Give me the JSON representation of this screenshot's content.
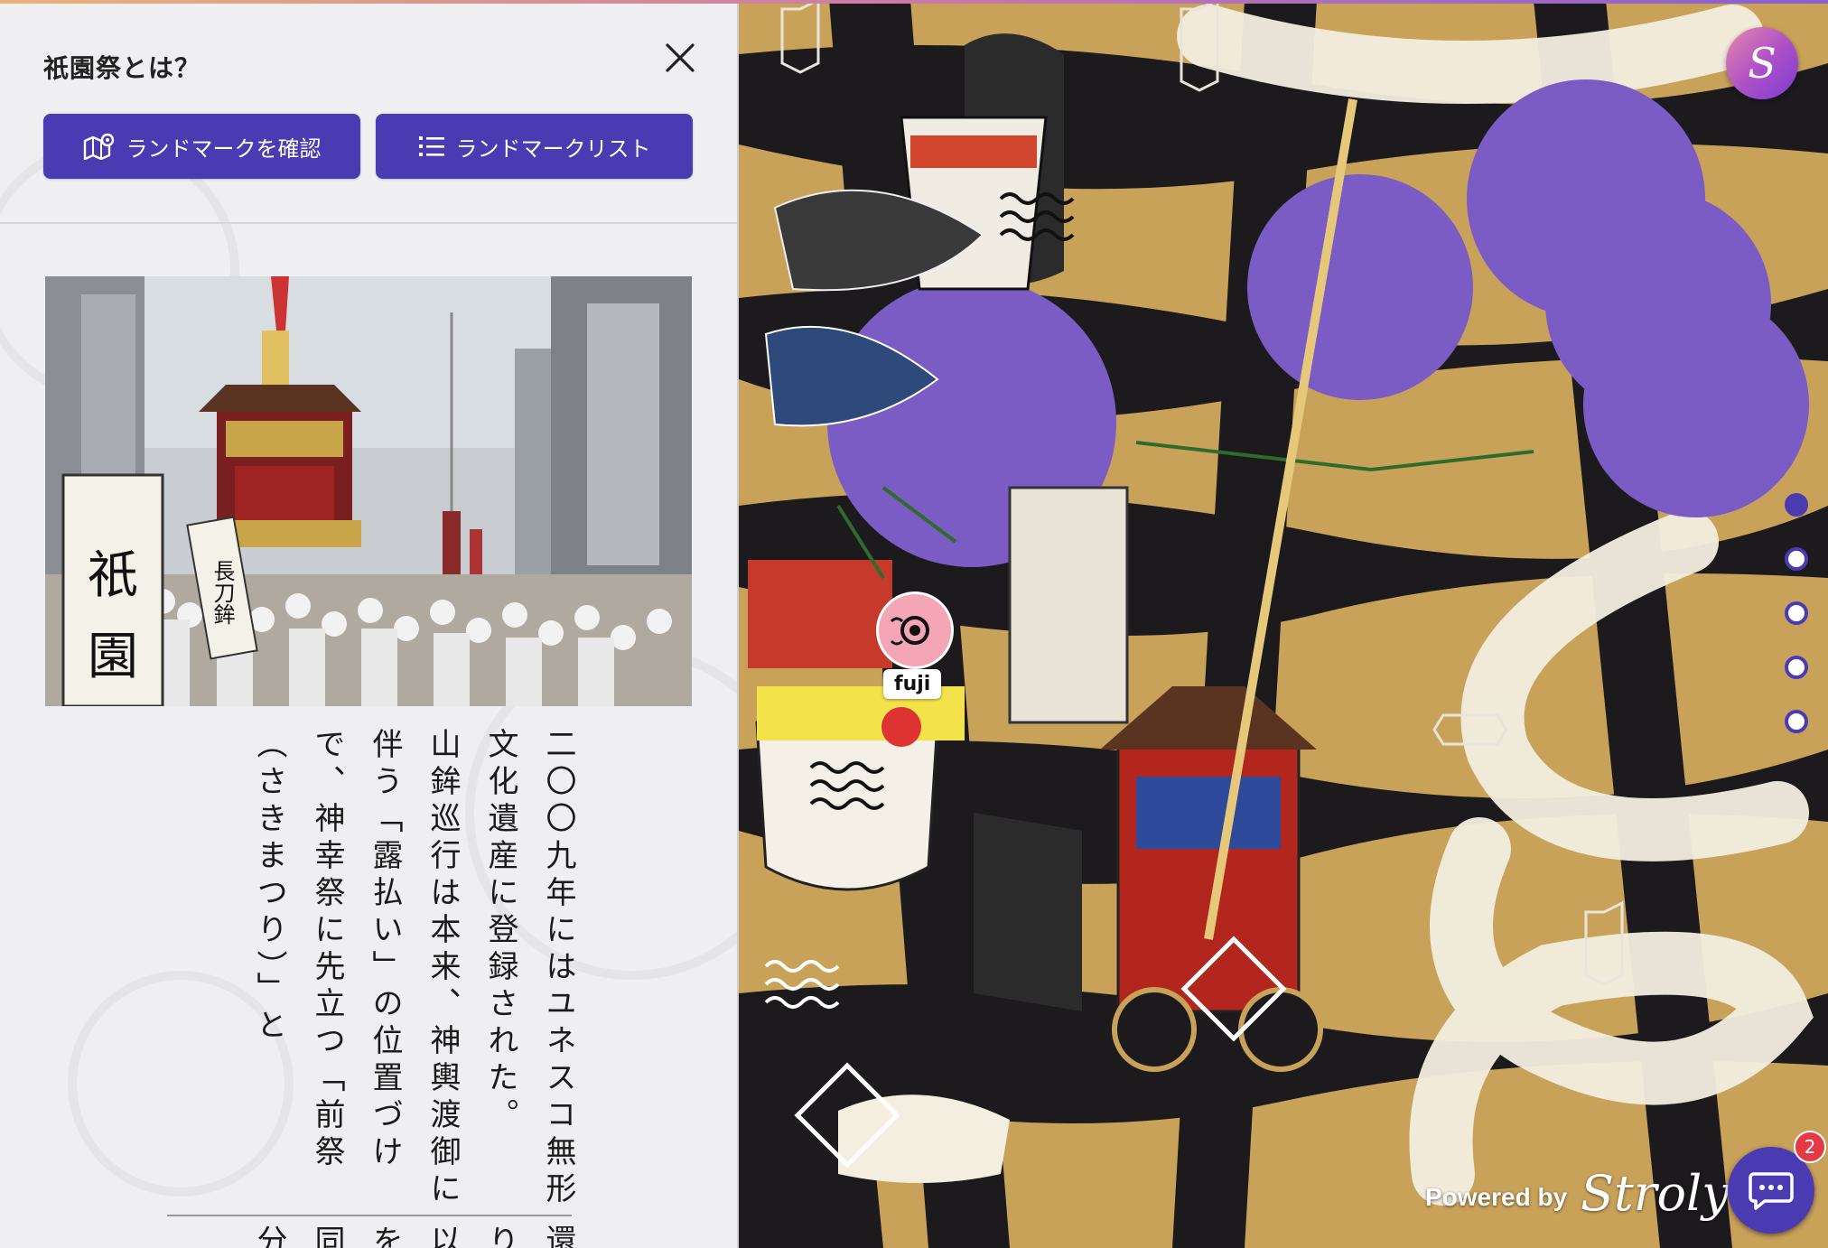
{
  "panel": {
    "title": "祇園祭とは？",
    "close_icon": "close-icon",
    "buttons": {
      "landmark_check": "ランドマークを確認",
      "landmark_list": "ランドマークリスト"
    },
    "photo_banner_texts": [
      "祇",
      "園",
      "長刀鉾"
    ],
    "article_paragraphs": [
      "二〇〇九年にはユネスコ無形文化遺産に登録された。",
      "山鉾巡行は本来、神輿渡御に伴う「露払い」の位置づけで、神幸祭に先立つ「前祭（さきまつり）」と"
    ],
    "article_next": "還り以を同分"
  },
  "map": {
    "marker_label": "fuji",
    "powered_by": "Powered by",
    "brand": "Stroly",
    "logo_letter": "S",
    "chat_badge_count": "2",
    "pagination_active_index": 0
  },
  "colors": {
    "accent": "#4b3bb3",
    "badge": "#e53945",
    "map_gold": "#c9a25a",
    "map_purple": "#7b5bc4"
  }
}
